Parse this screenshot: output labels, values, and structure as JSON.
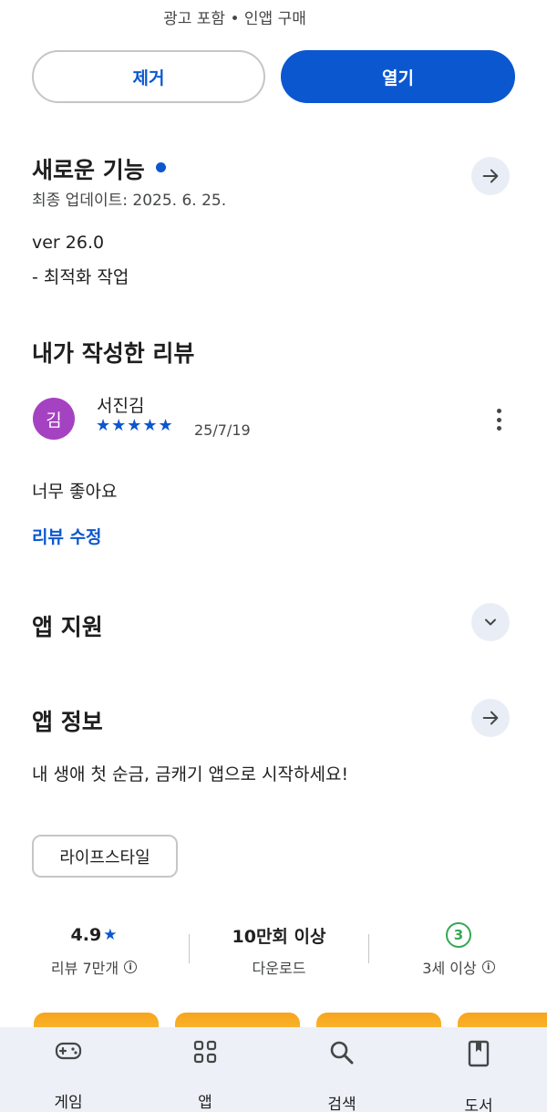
{
  "header": {
    "meta": "광고 포함 • 인앱 구매"
  },
  "actions": {
    "remove_label": "제거",
    "open_label": "열기"
  },
  "whats_new": {
    "title": "새로운 기능",
    "updated": "최종 업데이트: 2025. 6. 25.",
    "version": "ver 26.0",
    "notes": "- 최적화 작업"
  },
  "my_review": {
    "title": "내가 작성한 리뷰",
    "avatar_letter": "김",
    "reviewer": "서진김",
    "stars": "★★★★★",
    "rating": 5,
    "date": "25/7/19",
    "text": "너무 좋아요",
    "edit_label": "리뷰 수정"
  },
  "app_support": {
    "title": "앱 지원"
  },
  "app_info": {
    "title": "앱 정보",
    "description": "내 생애 첫 순금, 금캐기 앱으로 시작하세요!",
    "category": "라이프스타일"
  },
  "stats": {
    "rating": "4.9",
    "rating_label": "리뷰 7만개",
    "downloads": "10만회 이상",
    "downloads_label": "다운로드",
    "age": "3",
    "age_label": "3세 이상"
  },
  "nav": {
    "games": "게임",
    "apps": "앱",
    "search": "검색",
    "books": "도서"
  },
  "colors": {
    "accent": "#0b57d0",
    "avatar": "#a442c1",
    "age_badge": "#34a853",
    "nav_bg": "#edf1f7"
  }
}
